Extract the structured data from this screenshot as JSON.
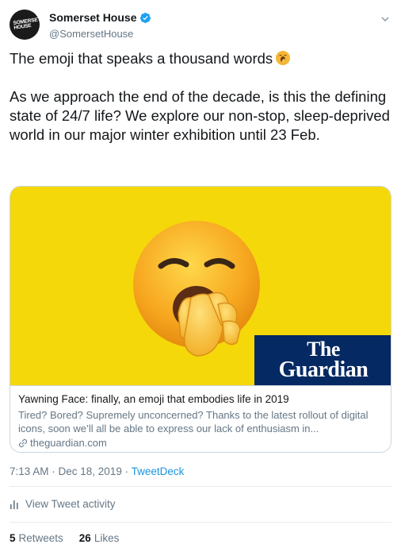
{
  "author": {
    "display_name": "Somerset House",
    "handle": "@SomersetHouse",
    "avatar_text_line1": "SOMERSET",
    "avatar_text_line2": "HOUSE"
  },
  "tweet": {
    "line1": "The emoji that speaks a thousand words",
    "line2": "As we approach the end of the decade, is this the defining state of 24/7 life? We explore our non-stop, sleep-deprived world in our major winter exhibition until 23 Feb.",
    "inline_emoji": "yawning-face-emoji"
  },
  "card": {
    "logo_line1": "The",
    "logo_line2": "Guardian",
    "title": "Yawning Face: finally, an emoji that embodies life in 2019",
    "description": "Tired? Bored? Supremely unconcerned? Thanks to the latest rollout of digital icons, soon we’ll all be able to express our lack of enthusiasm in...",
    "domain": "theguardian.com",
    "image_bg": "#f5d80a",
    "logo_bg": "#052962"
  },
  "meta": {
    "time": "7:13 AM · Dec 18, 2019 · ",
    "source": "TweetDeck"
  },
  "activity": {
    "label": "View Tweet activity"
  },
  "stats": {
    "retweets_count": "5",
    "retweets_label": "Retweets",
    "likes_count": "26",
    "likes_label": "Likes"
  },
  "colors": {
    "accent": "#1b95e0",
    "secondary_text": "#657786",
    "verified": "#1da1f2"
  }
}
